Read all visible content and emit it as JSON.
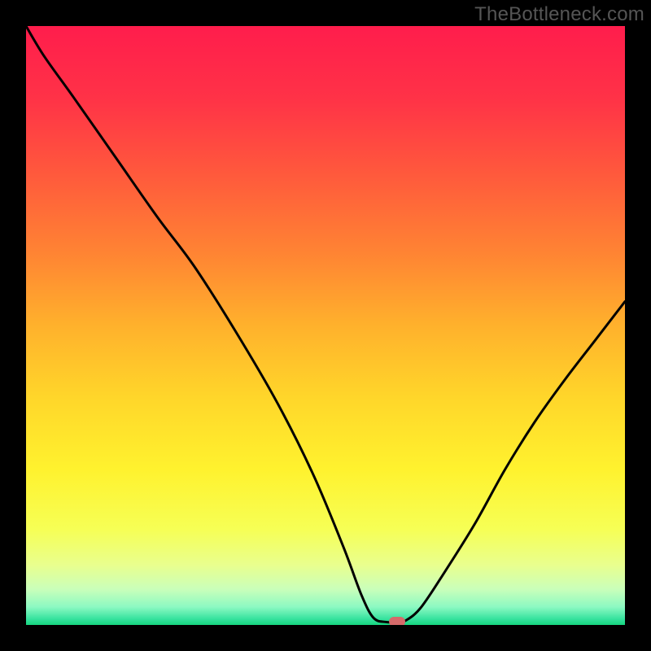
{
  "watermark": "TheBottleneck.com",
  "chart_data": {
    "type": "line",
    "title": "",
    "xlabel": "",
    "ylabel": "",
    "xlim": [
      0,
      100
    ],
    "ylim": [
      0,
      100
    ],
    "x": [
      0,
      3,
      8,
      15,
      22,
      28,
      35,
      42,
      48,
      53,
      56,
      58,
      60,
      62,
      63.5,
      66,
      70,
      75,
      80,
      85,
      90,
      95,
      100
    ],
    "values": [
      100,
      95,
      88,
      78,
      68,
      60,
      49,
      37,
      25,
      13,
      5,
      1.2,
      0.5,
      0.5,
      0.8,
      3,
      9,
      17,
      26,
      34,
      41,
      47.5,
      54
    ],
    "marker": {
      "x": 62,
      "y": 0.5
    },
    "background_gradient": {
      "stops": [
        {
          "offset": 0.0,
          "color": "#ff1d4c"
        },
        {
          "offset": 0.12,
          "color": "#ff3247"
        },
        {
          "offset": 0.25,
          "color": "#ff5a3c"
        },
        {
          "offset": 0.38,
          "color": "#ff8433"
        },
        {
          "offset": 0.5,
          "color": "#ffb12c"
        },
        {
          "offset": 0.62,
          "color": "#ffd62a"
        },
        {
          "offset": 0.74,
          "color": "#fff22e"
        },
        {
          "offset": 0.84,
          "color": "#f6ff55"
        },
        {
          "offset": 0.9,
          "color": "#e9ff8e"
        },
        {
          "offset": 0.94,
          "color": "#caffba"
        },
        {
          "offset": 0.97,
          "color": "#8cf9c2"
        },
        {
          "offset": 0.99,
          "color": "#36e29e"
        },
        {
          "offset": 1.0,
          "color": "#16d67f"
        }
      ]
    }
  }
}
